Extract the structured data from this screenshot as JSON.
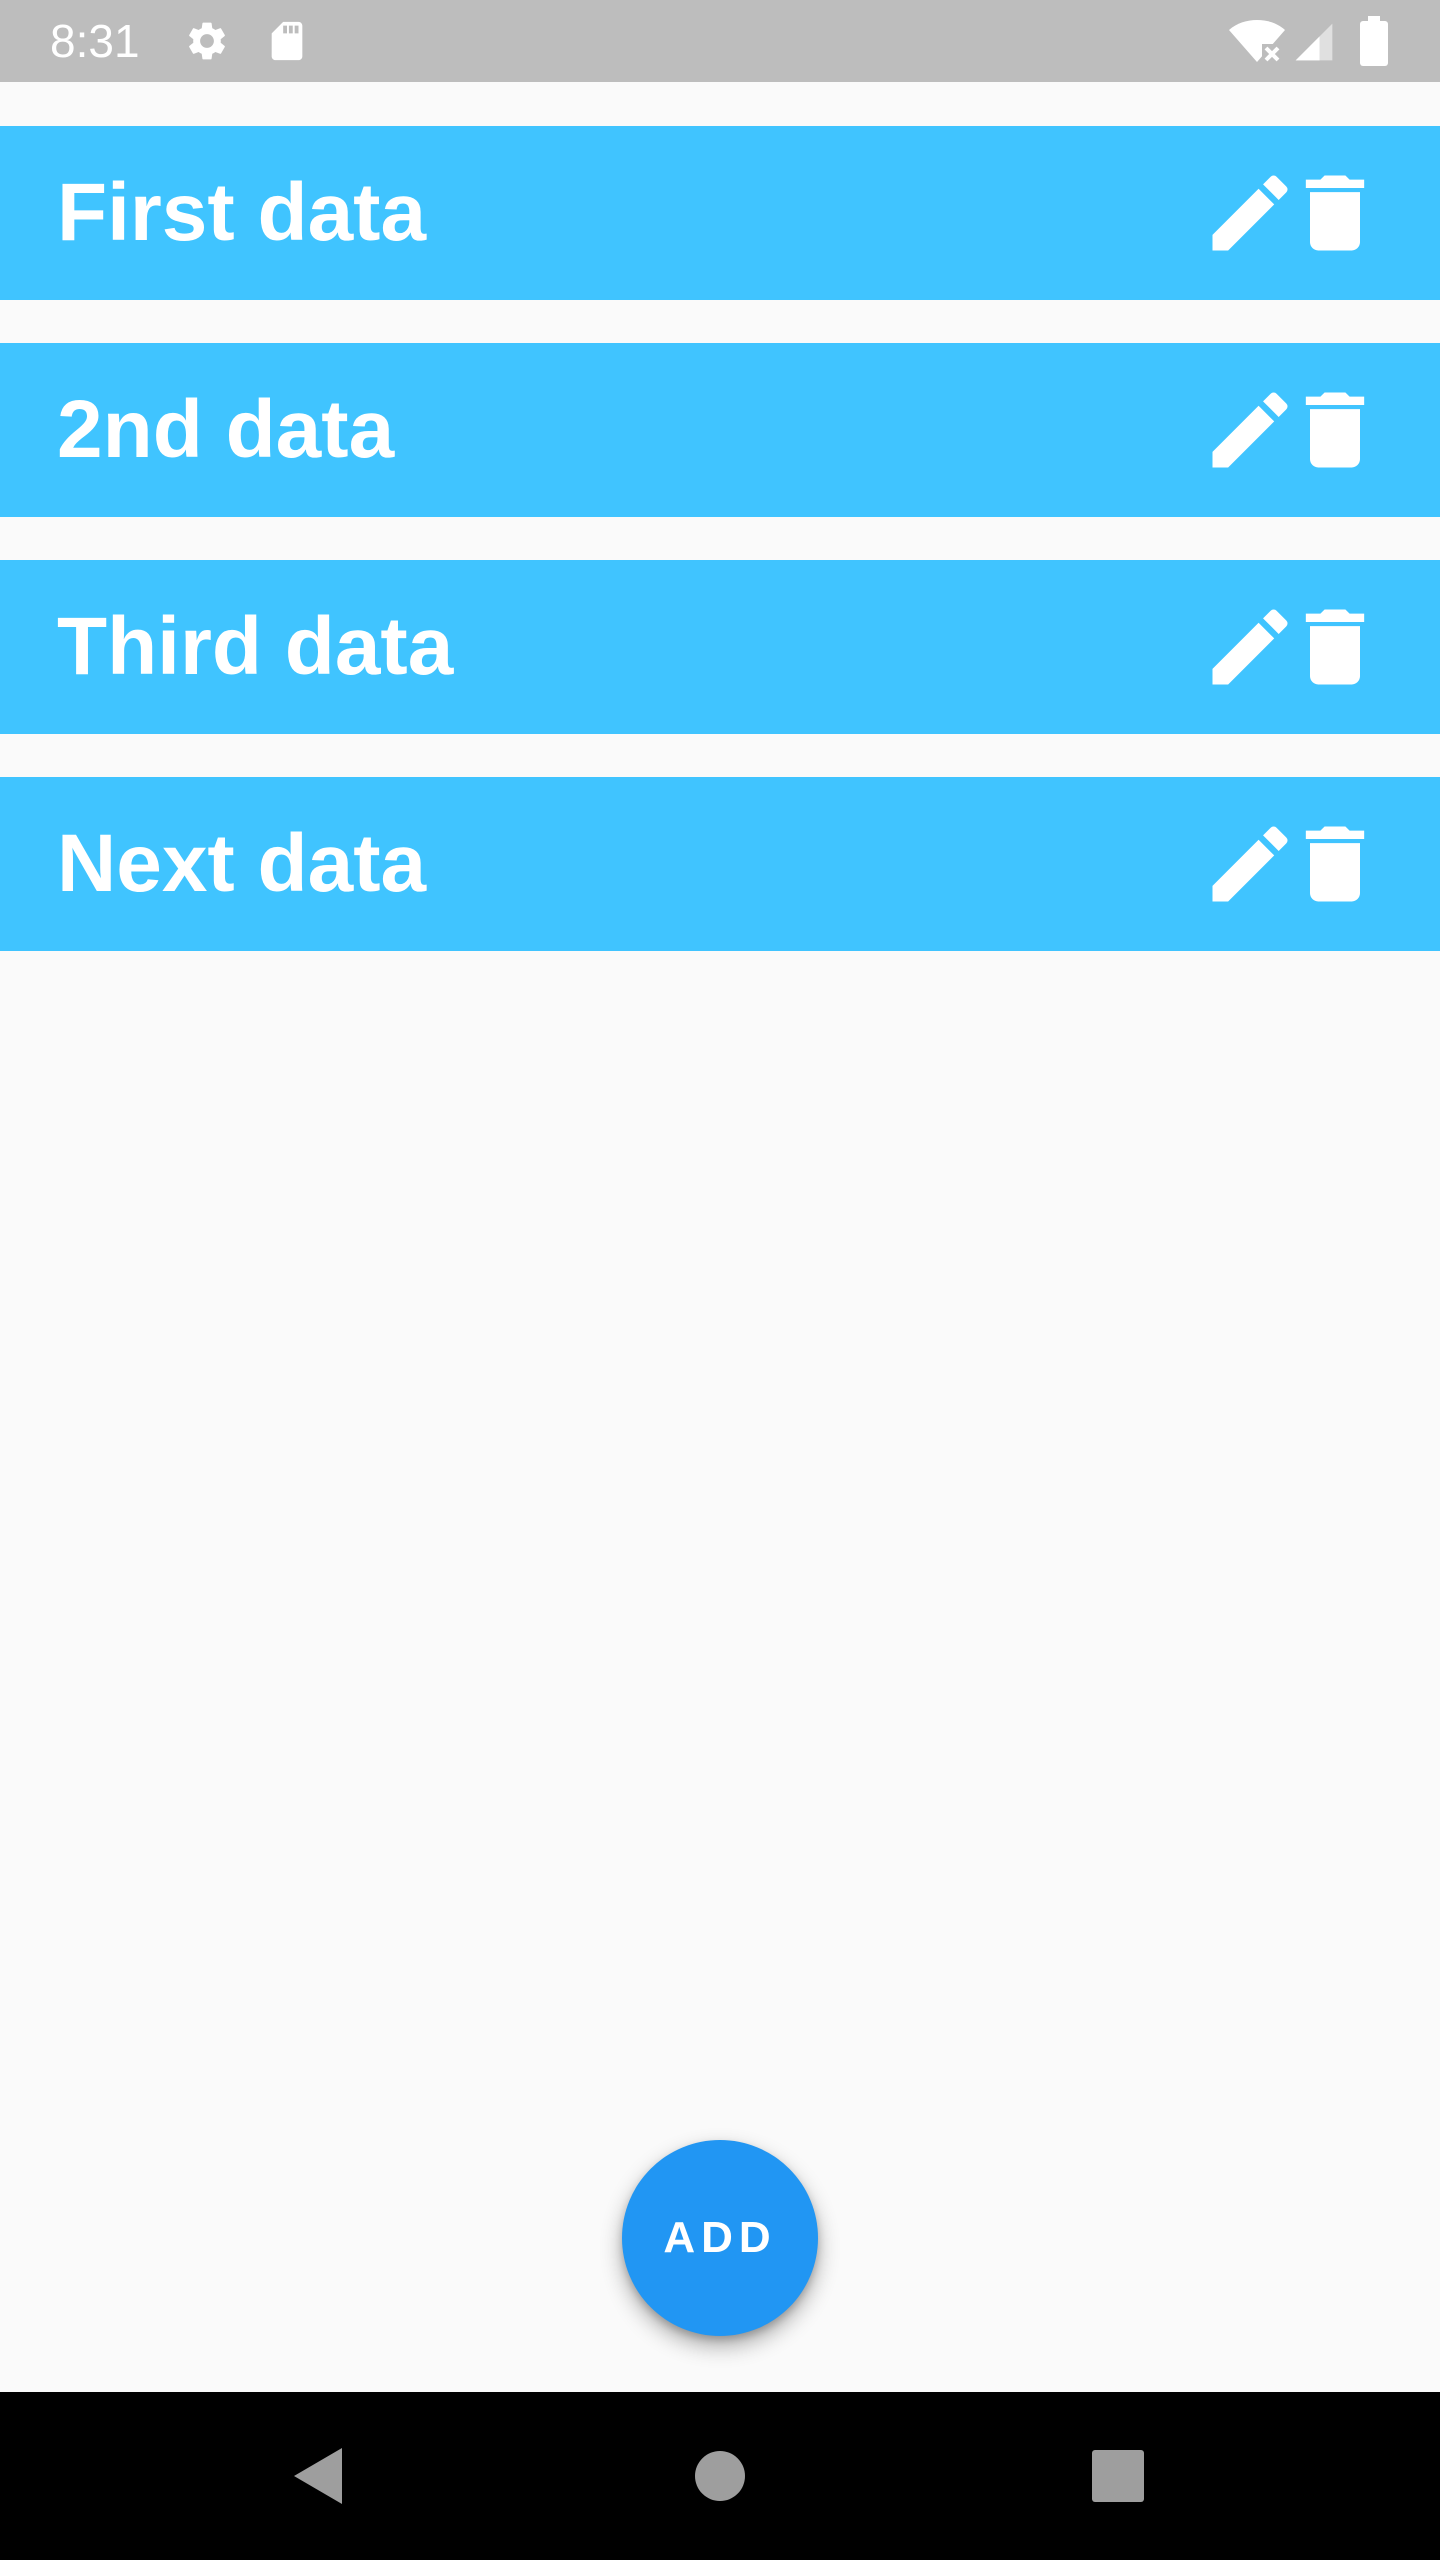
{
  "status_bar": {
    "time": "8:31",
    "icons": [
      "settings-icon",
      "sd-card-icon",
      "wifi-off-icon",
      "cell-signal-icon",
      "battery-icon"
    ]
  },
  "items": [
    {
      "label": "First data"
    },
    {
      "label": "2nd data"
    },
    {
      "label": "Third data"
    },
    {
      "label": "Next data"
    }
  ],
  "fab": {
    "label": "ADD"
  },
  "colors": {
    "item_background": "#40c4ff",
    "fab_background": "#2196f3",
    "status_bar": "#bdbdbd",
    "nav_bar": "#000000"
  },
  "nav_bar": {
    "buttons": [
      "back-icon",
      "home-icon",
      "recents-icon"
    ]
  }
}
